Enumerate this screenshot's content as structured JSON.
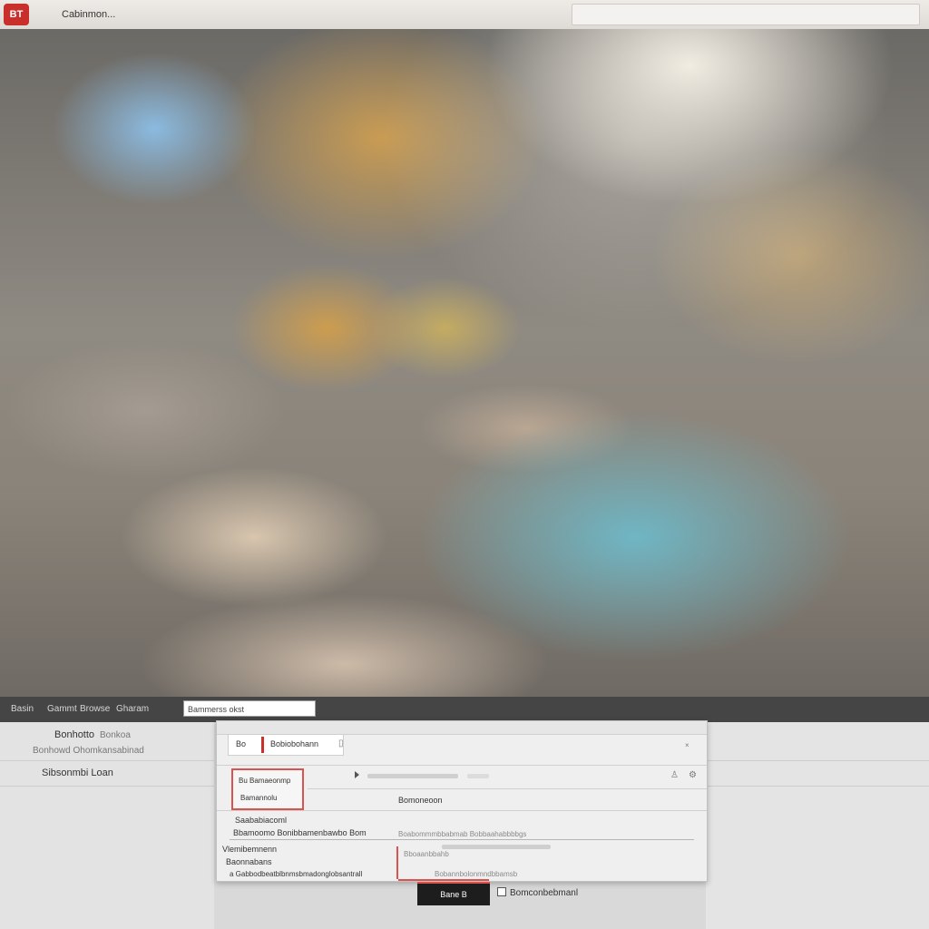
{
  "titlebar": {
    "logo_text": "BT",
    "window_title": "Cabinmon..."
  },
  "toolbar_strip": {
    "labels": [
      "Basin",
      "Gammt",
      "Browse",
      "Gharam"
    ],
    "field_value": "Bammerss okst"
  },
  "left_list": {
    "items": [
      {
        "title": "Bonhotto",
        "subtitle": "Bonkoa",
        "detail": "Bonhowd Ohomkansabinad"
      },
      {
        "title": "Sibsonmbi Loan",
        "subtitle": "",
        "detail": ""
      }
    ]
  },
  "dialog": {
    "tab_left": "Bo",
    "tab_right": "Bobiobohann",
    "field_line1": "Bu Bamaeonmp",
    "field_line2": "Bamannolu",
    "row1_text": "Bomoneoon",
    "section1_title": "Saababiacoml",
    "section1_subtitle": "Bbamoomo Bonibbamenbawbo Bom",
    "section1_value": "Boabommmbbabmab Bobbaahabbbbgs",
    "section2_title": "Vlemibemnenn",
    "section2_subtitle": "Baonnabans",
    "section2_value": "Bboaanbbahb",
    "footer_note": "a Gabbodbeatblbnmsbmadonglobsantrall",
    "footer_right": "Bobannbolonmndbbamsb"
  },
  "primary_button": {
    "label": "Bane B"
  },
  "checkbox": {
    "label": "Bomconbebmanl",
    "checked": false
  }
}
